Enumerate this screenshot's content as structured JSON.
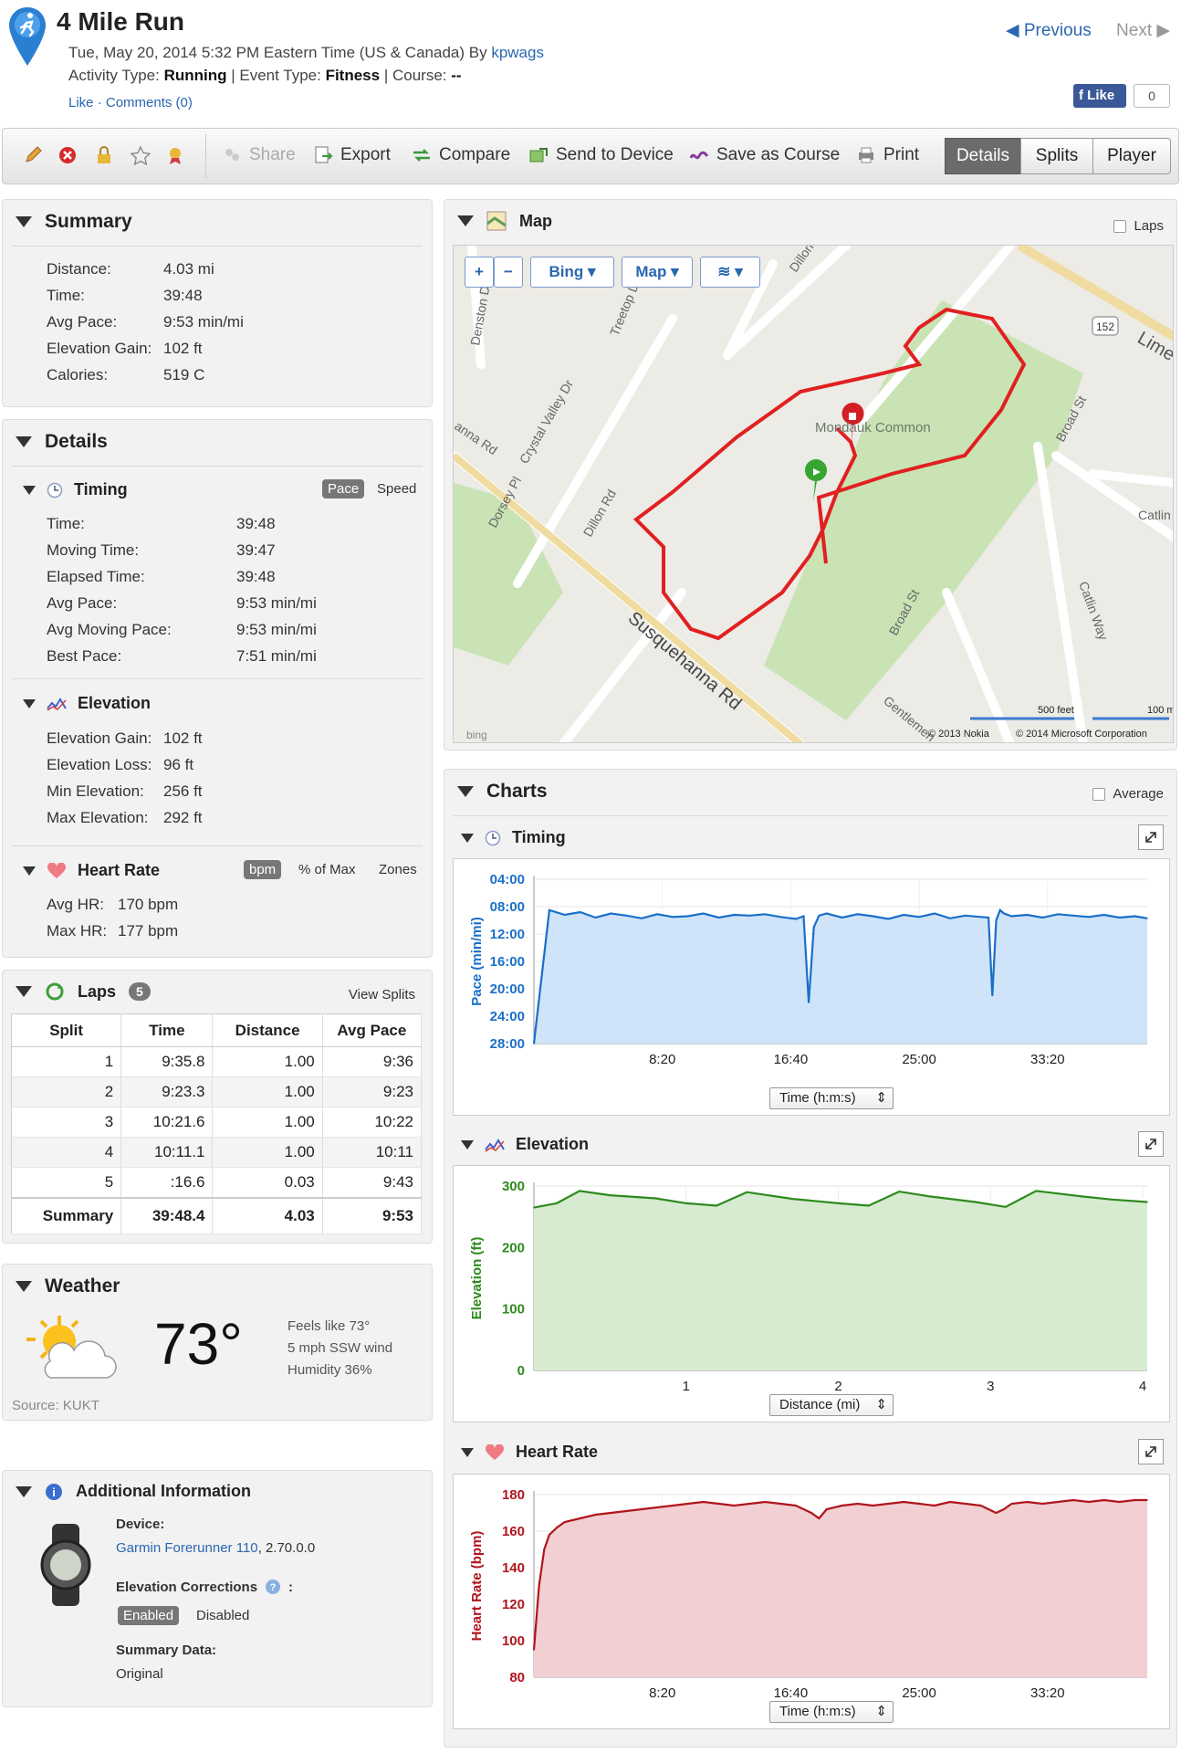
{
  "header": {
    "title": "4 Mile Run",
    "date_text": "Tue, May 20, 2014 5:32 PM Eastern Time (US & Canada) By",
    "author": "kpwags",
    "activity_type_label": "Activity Type:",
    "activity_type": "Running",
    "event_type_label": "| Event Type:",
    "event_type": "Fitness",
    "course_label": "| Course:",
    "course": "--",
    "like": "Like",
    "comments": "· Comments (0)",
    "previous": "Previous",
    "next": "Next",
    "fb_like": "Like",
    "fb_count": "0"
  },
  "toolbar": {
    "share": "Share",
    "export": "Export",
    "compare": "Compare",
    "send": "Send to Device",
    "save_course": "Save as Course",
    "print": "Print",
    "tabs": [
      "Details",
      "Splits",
      "Player"
    ]
  },
  "summary": {
    "title": "Summary",
    "rows": [
      {
        "k": "Distance:",
        "v": "4.03 mi"
      },
      {
        "k": "Time:",
        "v": "39:48"
      },
      {
        "k": "Avg Pace:",
        "v": "9:53 min/mi"
      },
      {
        "k": "Elevation Gain:",
        "v": "102 ft"
      },
      {
        "k": "Calories:",
        "v": "519 C"
      }
    ]
  },
  "details": {
    "title": "Details",
    "timing": {
      "title": "Timing",
      "pace": "Pace",
      "speed": "Speed",
      "rows": [
        {
          "k": "Time:",
          "v": "39:48"
        },
        {
          "k": "Moving Time:",
          "v": "39:47"
        },
        {
          "k": "Elapsed Time:",
          "v": "39:48"
        },
        {
          "k": "Avg Pace:",
          "v": "9:53 min/mi"
        },
        {
          "k": "Avg Moving Pace:",
          "v": "9:53 min/mi"
        },
        {
          "k": "Best Pace:",
          "v": "7:51 min/mi"
        }
      ]
    },
    "elevation": {
      "title": "Elevation",
      "rows": [
        {
          "k": "Elevation Gain:",
          "v": "102 ft"
        },
        {
          "k": "Elevation Loss:",
          "v": "96 ft"
        },
        {
          "k": "Min Elevation:",
          "v": "256 ft"
        },
        {
          "k": "Max Elevation:",
          "v": "292 ft"
        }
      ]
    },
    "heart_rate": {
      "title": "Heart Rate",
      "bpm": "bpm",
      "pct": "% of Max",
      "zones": "Zones",
      "rows": [
        {
          "k": "Avg HR:",
          "v": "170 bpm"
        },
        {
          "k": "Max HR:",
          "v": "177 bpm"
        }
      ]
    }
  },
  "laps": {
    "title": "Laps",
    "count": "5",
    "view_splits": "View Splits",
    "headers": [
      "Split",
      "Time",
      "Distance",
      "Avg Pace"
    ],
    "rows": [
      [
        "1",
        "9:35.8",
        "1.00",
        "9:36"
      ],
      [
        "2",
        "9:23.3",
        "1.00",
        "9:23"
      ],
      [
        "3",
        "10:21.6",
        "1.00",
        "10:22"
      ],
      [
        "4",
        "10:11.1",
        "1.00",
        "10:11"
      ],
      [
        "5",
        ":16.6",
        "0.03",
        "9:43"
      ]
    ],
    "summary": [
      "Summary",
      "39:48.4",
      "4.03",
      "9:53"
    ]
  },
  "weather": {
    "title": "Weather",
    "temp": "73°",
    "feels": "Feels like 73°",
    "wind": "5 mph SSW wind",
    "humidity": "Humidity 36%",
    "source": "Source: KUKT"
  },
  "additional": {
    "title": "Additional Information",
    "device_label": "Device:",
    "device": "Garmin Forerunner 110",
    "device_ver": ", 2.70.0.0",
    "elev_corr": "Elevation Corrections",
    "colon": ":",
    "enabled": "Enabled",
    "disabled": "Disabled",
    "summary_label": "Summary Data:",
    "summary_val": "Original"
  },
  "map": {
    "title": "Map",
    "laps": "Laps",
    "bing": "Bing",
    "map": "Map",
    "park": "Mondauk Common",
    "roads": [
      "Dillon",
      "Treetop Ln",
      "Denston D",
      "Crystal Valley Dr",
      "anna Rd",
      "Dorsey Pl",
      "Dillon Rd",
      "Susquehanna Rd",
      "Broad St",
      "Broad St",
      "Catlin",
      "Catlin Way",
      "Gentlemen",
      "Lime"
    ],
    "route_badge": "152",
    "scale_ft": "500 feet",
    "scale_m": "100 m",
    "attribution1": "© 2013 Nokia",
    "attribution2": "© 2014 Microsoft Corporation",
    "bing_logo": "bing"
  },
  "charts": {
    "title": "Charts",
    "average": "Average",
    "timing": {
      "title": "Timing",
      "ylabel": "Pace (min/mi)",
      "selector": "Time (h:m:s)"
    },
    "elevation": {
      "title": "Elevation",
      "ylabel": "Elevation (ft)",
      "selector": "Distance (mi)"
    },
    "hr": {
      "title": "Heart Rate",
      "ylabel": "Heart Rate (bpm)",
      "selector": "Time (h:m:s)"
    }
  },
  "chart_data": [
    {
      "type": "line",
      "title": "Timing",
      "ylabel": "Pace (min/mi)",
      "xlabel": "Time (h:m:s)",
      "yticks": [
        "04:00",
        "08:00",
        "12:00",
        "16:00",
        "20:00",
        "24:00",
        "28:00"
      ],
      "xticks": [
        "8:20",
        "16:40",
        "25:00",
        "33:20"
      ],
      "ylim_minutes": [
        4,
        28
      ],
      "y_inverted": true,
      "x_seconds": [
        0,
        60,
        120,
        180,
        240,
        300,
        360,
        420,
        480,
        540,
        600,
        660,
        720,
        780,
        840,
        900,
        960,
        1020,
        1050,
        1070,
        1090,
        1110,
        1140,
        1200,
        1260,
        1320,
        1380,
        1440,
        1500,
        1560,
        1620,
        1680,
        1740,
        1770,
        1785,
        1800,
        1815,
        1830,
        1860,
        1920,
        1980,
        2040,
        2100,
        2160,
        2220,
        2280,
        2340,
        2388
      ],
      "y_minutes": [
        28,
        8.5,
        9.2,
        8.8,
        9.6,
        9.0,
        9.3,
        9.7,
        9.1,
        9.5,
        9.4,
        9.0,
        9.6,
        9.2,
        9.3,
        9.1,
        9.5,
        9.8,
        9.4,
        22,
        11,
        9.3,
        9.0,
        9.6,
        9.1,
        9.4,
        9.8,
        9.2,
        9.5,
        9.0,
        9.7,
        9.3,
        9.5,
        9.6,
        21,
        10,
        8.5,
        9.0,
        9.4,
        9.2,
        9.6,
        9.1,
        9.3,
        9.5,
        9.2,
        9.6,
        9.4,
        9.7
      ],
      "fill": "#cfe3f9",
      "stroke": "#1a6fc9"
    },
    {
      "type": "area",
      "title": "Elevation",
      "ylabel": "Elevation (ft)",
      "xlabel": "Distance (mi)",
      "yticks": [
        "0",
        "100",
        "200",
        "300"
      ],
      "xticks": [
        "1",
        "2",
        "3",
        "4"
      ],
      "ylim": [
        0,
        300
      ],
      "x": [
        0,
        0.15,
        0.3,
        0.5,
        0.8,
        1.0,
        1.2,
        1.4,
        1.7,
        2.0,
        2.2,
        2.4,
        2.6,
        2.9,
        3.1,
        3.3,
        3.6,
        3.8,
        4.03
      ],
      "y": [
        265,
        272,
        292,
        285,
        280,
        272,
        268,
        290,
        279,
        272,
        268,
        291,
        283,
        274,
        266,
        292,
        283,
        278,
        274
      ],
      "fill": "#d6ebd0",
      "stroke": "#2e8a1e"
    },
    {
      "type": "area",
      "title": "Heart Rate",
      "ylabel": "Heart Rate (bpm)",
      "xlabel": "Time (h:m:s)",
      "yticks": [
        "80",
        "100",
        "120",
        "140",
        "160",
        "180"
      ],
      "xticks": [
        "8:20",
        "16:40",
        "25:00",
        "33:20"
      ],
      "ylim": [
        80,
        180
      ],
      "x_seconds": [
        0,
        20,
        40,
        60,
        90,
        120,
        180,
        240,
        300,
        360,
        420,
        480,
        540,
        600,
        660,
        720,
        780,
        840,
        900,
        960,
        1020,
        1080,
        1110,
        1140,
        1200,
        1260,
        1320,
        1380,
        1440,
        1500,
        1560,
        1620,
        1680,
        1740,
        1800,
        1830,
        1860,
        1920,
        1980,
        2040,
        2100,
        2160,
        2220,
        2280,
        2340,
        2388
      ],
      "y": [
        95,
        130,
        150,
        158,
        162,
        165,
        167,
        169,
        170,
        171,
        172,
        173,
        174,
        175,
        176,
        175,
        174,
        175,
        176,
        175,
        174,
        170,
        167,
        172,
        174,
        175,
        174,
        175,
        176,
        175,
        174,
        176,
        175,
        174,
        170,
        172,
        175,
        176,
        175,
        176,
        177,
        176,
        177,
        176,
        177,
        177
      ],
      "fill": "#f1cfd2",
      "stroke": "#b0151c"
    }
  ]
}
